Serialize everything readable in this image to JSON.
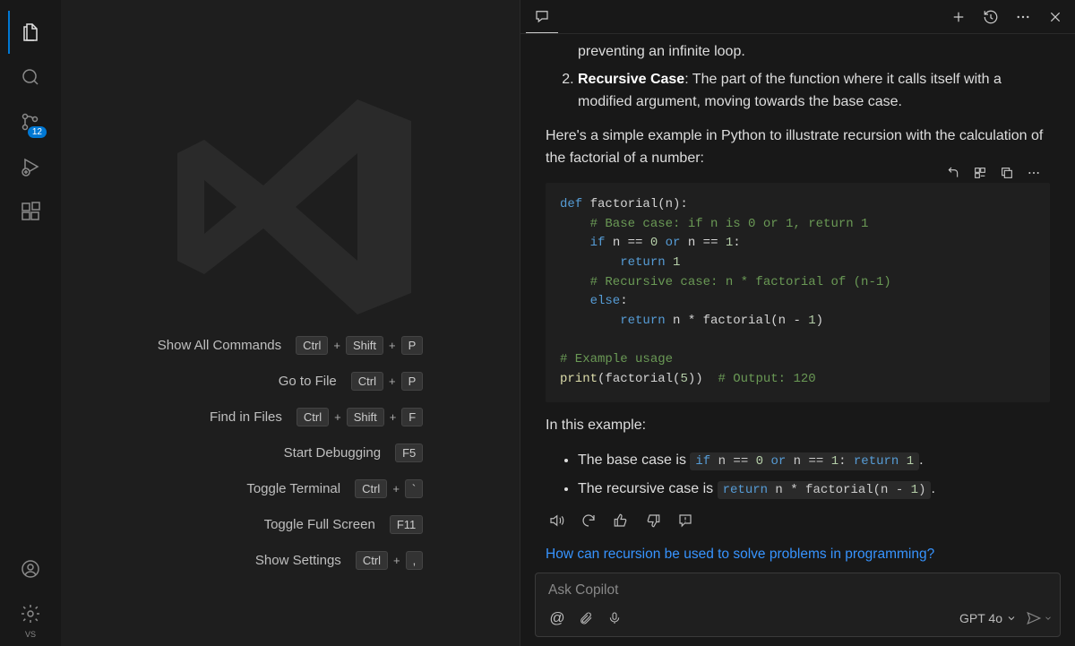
{
  "activity": {
    "scm_badge": "12",
    "vs_tag": "VS"
  },
  "welcome": {
    "items": [
      {
        "label": "Show All Commands",
        "keys": [
          "Ctrl",
          "Shift",
          "P"
        ]
      },
      {
        "label": "Go to File",
        "keys": [
          "Ctrl",
          "P"
        ]
      },
      {
        "label": "Find in Files",
        "keys": [
          "Ctrl",
          "Shift",
          "F"
        ]
      },
      {
        "label": "Start Debugging",
        "keys": [
          "F5"
        ]
      },
      {
        "label": "Toggle Terminal",
        "keys": [
          "Ctrl",
          "`"
        ]
      },
      {
        "label": "Toggle Full Screen",
        "keys": [
          "F11"
        ]
      },
      {
        "label": "Show Settings",
        "keys": [
          "Ctrl",
          ","
        ]
      }
    ]
  },
  "chat": {
    "ol1_leading": "preventing an infinite loop.",
    "ol2_title": "Recursive Case",
    "ol2_body": ": The part of the function where it calls itself with a modified argument, moving towards the base case.",
    "intro": "Here's a simple example in Python to illustrate recursion with the calculation of the factorial of a number:",
    "code": {
      "l1a": "def",
      "l1b": " factorial(n):",
      "l2": "    # Base case: if n is 0 or 1, return 1",
      "l3a": "    if",
      "l3b": " n == ",
      "l3c": "0",
      "l3d": " or",
      "l3e": " n == ",
      "l3f": "1",
      "l3g": ":",
      "l4a": "        return ",
      "l4b": "1",
      "l5": "    # Recursive case: n * factorial of (n-1)",
      "l6a": "    else",
      "l6b": ":",
      "l7a": "        return",
      "l7b": " n * factorial(n - ",
      "l7c": "1",
      "l7d": ")",
      "l8": "# Example usage",
      "l9a": "print",
      "l9b": "(factorial(",
      "l9c": "5",
      "l9d": "))  ",
      "l9e": "# Output: 120"
    },
    "after_code": "In this example:",
    "bullet1_lead": "The base case is ",
    "bullet1_code_a": "if",
    "bullet1_code_b": " n == ",
    "bullet1_code_c": "0",
    "bullet1_code_d": " or",
    "bullet1_code_e": " n == ",
    "bullet1_code_f": "1",
    "bullet1_code_g": ": ",
    "bullet1_code_h": "return ",
    "bullet1_code_i": "1",
    "bullet1_tail": ".",
    "bullet2_lead": "The recursive case is ",
    "bullet2_code_a": "return",
    "bullet2_code_b": " n * factorial(n - ",
    "bullet2_code_c": "1",
    "bullet2_code_d": ")",
    "bullet2_tail": ".",
    "suggestion": "How can recursion be used to solve problems in programming?",
    "input_placeholder": "Ask Copilot",
    "at_label": "@",
    "model": "GPT 4o"
  }
}
